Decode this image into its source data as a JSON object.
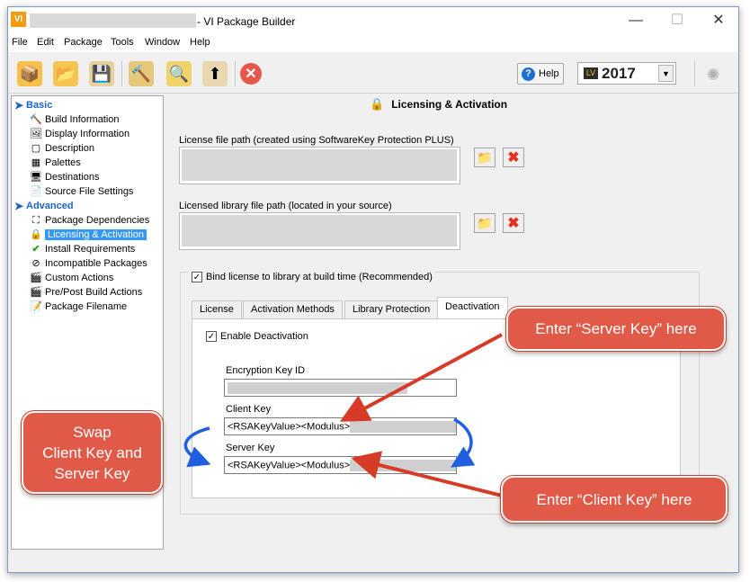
{
  "window": {
    "app_icon": "VI",
    "title": "- VI Package Builder",
    "min_glyph": "—",
    "max_glyph": "☐",
    "close_glyph": "✕"
  },
  "menu": [
    "File",
    "Edit",
    "Package",
    "Tools",
    "Window",
    "Help"
  ],
  "toolbar": {
    "help_label": "Help",
    "version": "2017",
    "version_icon": "LV"
  },
  "sidebar": {
    "basic_label": "Basic",
    "basic_items": [
      {
        "label": "Build Information",
        "icon": "hammer-icon"
      },
      {
        "label": "Display Information",
        "icon": "display-icon"
      },
      {
        "label": "Description",
        "icon": "description-icon"
      },
      {
        "label": "Palettes",
        "icon": "palette-icon"
      },
      {
        "label": "Destinations",
        "icon": "destination-icon"
      },
      {
        "label": "Source File Settings",
        "icon": "source-file-icon"
      }
    ],
    "advanced_label": "Advanced",
    "advanced_items": [
      {
        "label": "Package Dependencies",
        "icon": "dependencies-icon"
      },
      {
        "label": "Licensing & Activation",
        "icon": "lock-icon",
        "selected": true
      },
      {
        "label": "Install Requirements",
        "icon": "checkmark-icon"
      },
      {
        "label": "Incompatible Packages",
        "icon": "incompatible-icon"
      },
      {
        "label": "Custom Actions",
        "icon": "custom-actions-icon"
      },
      {
        "label": "Pre/Post Build Actions",
        "icon": "build-actions-icon"
      },
      {
        "label": "Package Filename",
        "icon": "filename-icon"
      }
    ]
  },
  "main": {
    "section_title": "Licensing & Activation",
    "license_path_label": "License file path (created using SoftwareKey Protection PLUS)",
    "library_path_label": "Licensed library file path (located in your source)",
    "bind_label": "Bind license to library at build time (Recommended)",
    "bind_checked": "✓",
    "tabs": [
      "License",
      "Activation Methods",
      "Library Protection",
      "Deactivation"
    ],
    "active_tab": "Deactivation",
    "enable_deactivation_label": "Enable Deactivation",
    "enable_checked": "✓",
    "encryption_key_label": "Encryption Key ID",
    "client_key_label": "Client Key",
    "client_key_value": "<RSAKeyValue><Modulus>",
    "server_key_label": "Server Key",
    "server_key_value": "<RSAKeyValue><Modulus>"
  },
  "callouts": {
    "server": "Enter “Server Key” here",
    "client": "Enter “Client Key” here",
    "swap_line1": "Swap",
    "swap_line2": "Client Key and",
    "swap_line3": "Server Key"
  },
  "colors": {
    "callout": "#e15a48",
    "arrow_red": "#d63b28",
    "arrow_blue": "#1f5fe0",
    "selection": "#3399ff"
  }
}
